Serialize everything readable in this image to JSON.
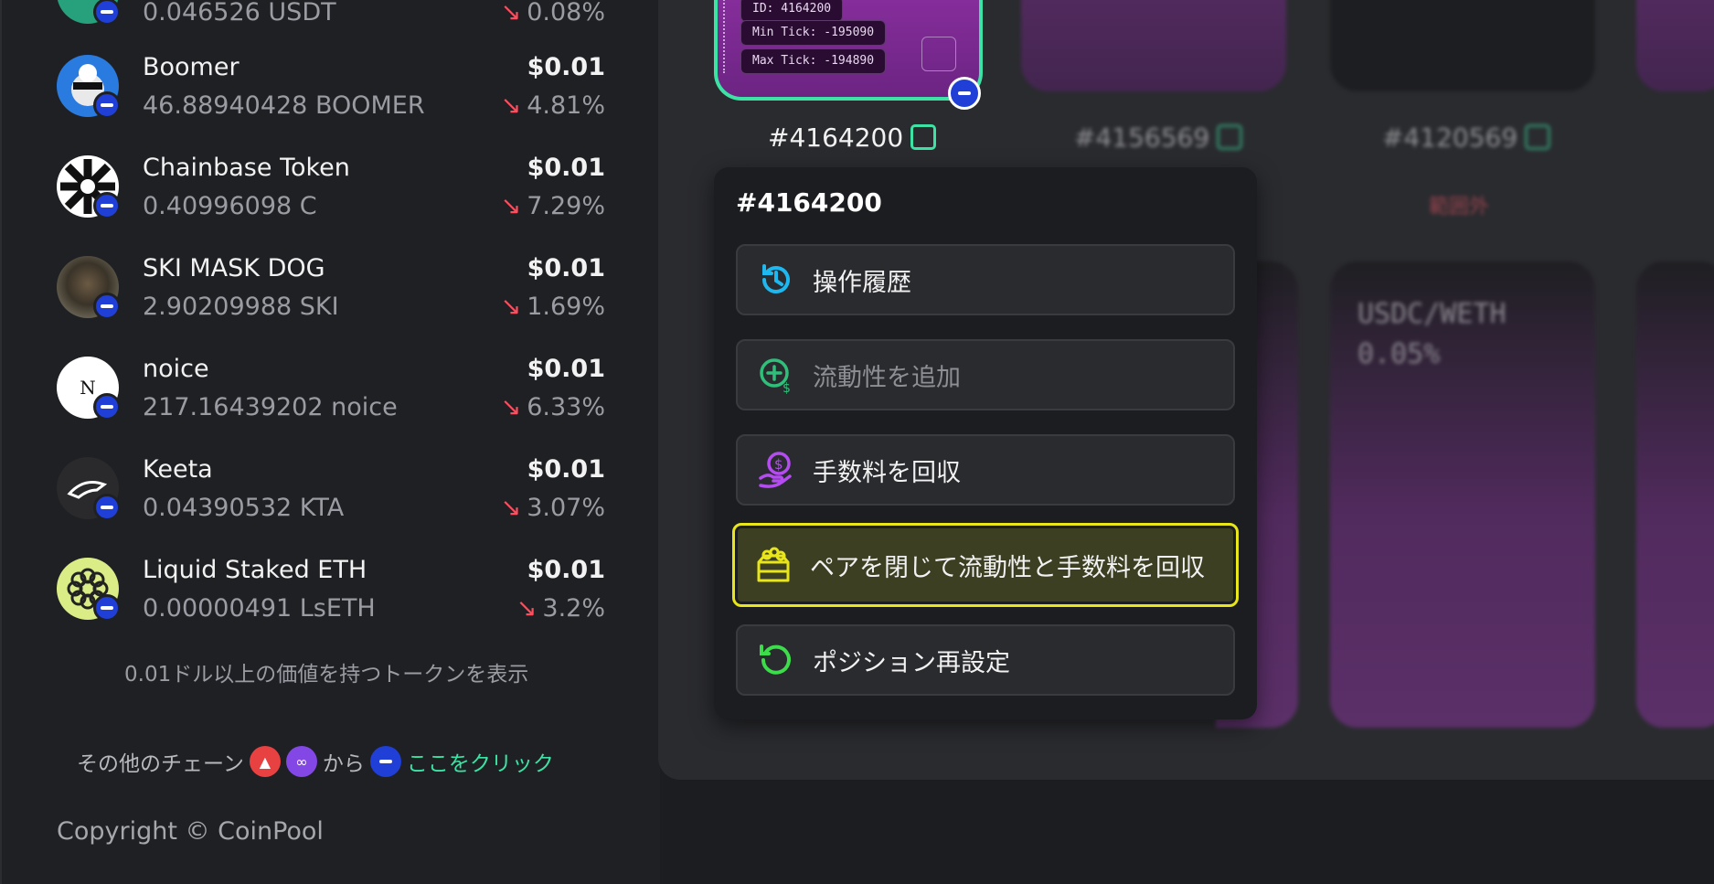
{
  "tokens": [
    {
      "name": "",
      "amount": "0.046526 USDT",
      "price": "",
      "change": "0.08%"
    },
    {
      "name": "Boomer",
      "amount": "46.88940428 BOOMER",
      "price": "$0.01",
      "change": "4.81%"
    },
    {
      "name": "Chainbase Token",
      "amount": "0.40996098 C",
      "price": "$0.01",
      "change": "7.29%"
    },
    {
      "name": "SKI MASK DOG",
      "amount": "2.90209988 SKI",
      "price": "$0.01",
      "change": "1.69%"
    },
    {
      "name": "noice",
      "amount": "217.16439202 noice",
      "price": "$0.01",
      "change": "6.33%"
    },
    {
      "name": "Keeta",
      "amount": "0.04390532 KTA",
      "price": "$0.01",
      "change": "3.07%"
    },
    {
      "name": "Liquid Staked ETH",
      "amount": "0.00000491 LsETH",
      "price": "$0.01",
      "change": "3.2%"
    }
  ],
  "sidebar": {
    "min_value_note": "0.01ドル以上の価値を持つトークンを表示",
    "other_chains_prefix": "その他のチェーン",
    "other_chains_from": "から",
    "click_here": "ここをクリック",
    "copyright": "Copyright © CoinPool"
  },
  "positions": {
    "selected": {
      "id_label": "#4164200",
      "id_field": "ID: 4164200",
      "min_tick": "Min Tick: -195090",
      "max_tick": "Max Tick: -194890"
    },
    "others": [
      "#4156569",
      "#4120569"
    ],
    "out_of_range": "範囲外",
    "pair_card": {
      "pair": "USDC/WETH",
      "fee": "0.05%"
    }
  },
  "menu": {
    "title": "#4164200",
    "items": [
      {
        "label": "操作履歴",
        "icon": "history-icon",
        "color": "#1eb8f0",
        "disabled": false
      },
      {
        "label": "流動性を追加",
        "icon": "add-liquidity-icon",
        "color": "#2fbf7a",
        "disabled": true
      },
      {
        "label": "手数料を回収",
        "icon": "collect-fees-icon",
        "color": "#b44cf0",
        "disabled": false
      },
      {
        "label": "ペアを閉じて流動性と手数料を回収",
        "icon": "close-pair-icon",
        "color": "#e8e51a",
        "disabled": false,
        "highlighted": true
      },
      {
        "label": "ポジション再設定",
        "icon": "reset-position-icon",
        "color": "#3ddc4a",
        "disabled": false
      }
    ]
  }
}
